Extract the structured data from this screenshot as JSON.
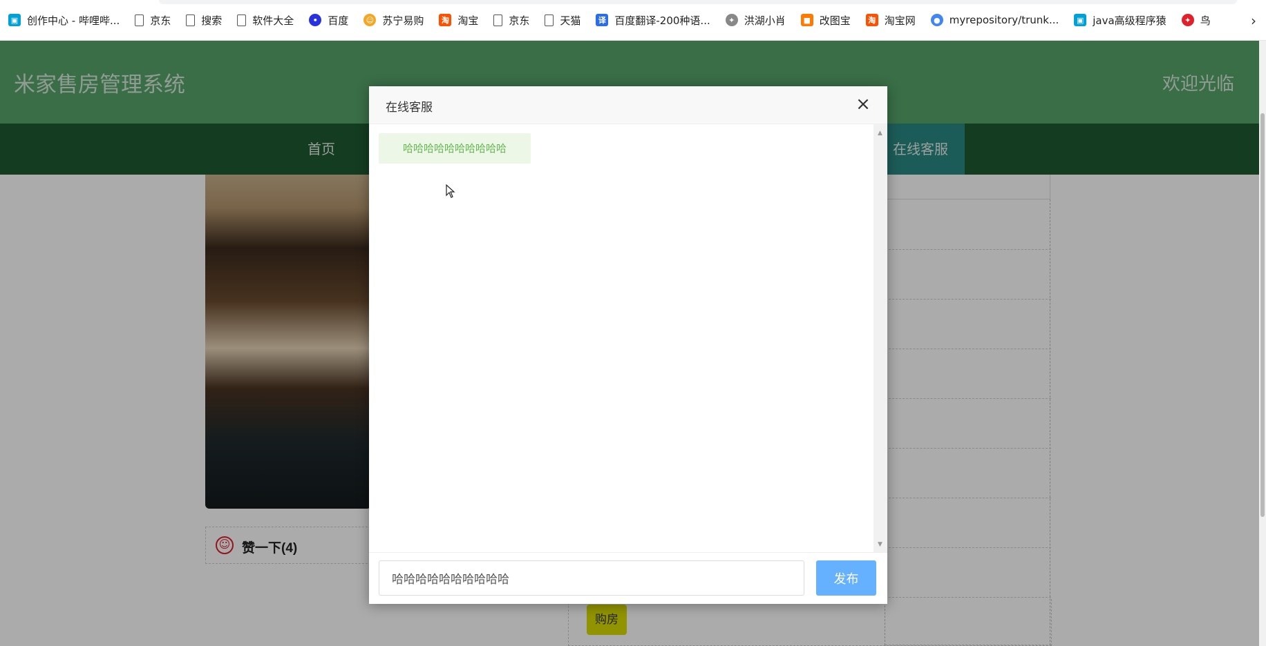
{
  "bookmarks": [
    {
      "label": "创作中心 - 哔哩哔...",
      "icon": "bilibili-icon",
      "color": "#00a1d6"
    },
    {
      "label": "京东",
      "icon": "page-icon"
    },
    {
      "label": "搜索",
      "icon": "page-icon"
    },
    {
      "label": "软件大全",
      "icon": "page-icon"
    },
    {
      "label": "百度",
      "icon": "baidu-icon",
      "color": "#2932e1"
    },
    {
      "label": "苏宁易购",
      "icon": "suning-icon",
      "color": "#f5a623"
    },
    {
      "label": "淘宝",
      "icon": "taobao-icon",
      "color": "#ff5000"
    },
    {
      "label": "京东",
      "icon": "page-icon"
    },
    {
      "label": "天猫",
      "icon": "page-icon"
    },
    {
      "label": "百度翻译-200种语...",
      "icon": "translate-icon",
      "color": "#2b6de8"
    },
    {
      "label": "洪湖小肖",
      "icon": "bird-icon",
      "color": "#888888"
    },
    {
      "label": "改图宝",
      "icon": "gaitubao-icon",
      "color": "#ff7a00"
    },
    {
      "label": "淘宝网",
      "icon": "taobao-icon",
      "color": "#ff5000"
    },
    {
      "label": "myrepository/trunk...",
      "icon": "chrome-icon",
      "color": "#4285f4"
    },
    {
      "label": "java高级程序猿",
      "icon": "bilibili-icon",
      "color": "#00a1d6"
    },
    {
      "label": "鸟",
      "icon": "bird-icon",
      "color": "#e0202a"
    }
  ],
  "site": {
    "title": "米家售房管理系统",
    "welcome": "欢迎光临",
    "nav": {
      "home": "首页",
      "support": "在线客服"
    },
    "like_label": "赞一下(4)",
    "buy_label": "购房"
  },
  "dialog": {
    "title": "在线客服",
    "close_symbol": "×",
    "messages": [
      "哈哈哈哈哈哈哈哈哈哈"
    ],
    "input_value": "哈哈哈哈哈哈哈哈哈哈",
    "send_label": "发布"
  },
  "colors": {
    "header": "#56a46a",
    "nav": "#1f5a32",
    "nav_active": "#2a8a83",
    "send_button": "#66b1ff",
    "message_bg": "#ecf7e8",
    "message_text": "#64b84d",
    "buy_button": "#d9dc00"
  }
}
